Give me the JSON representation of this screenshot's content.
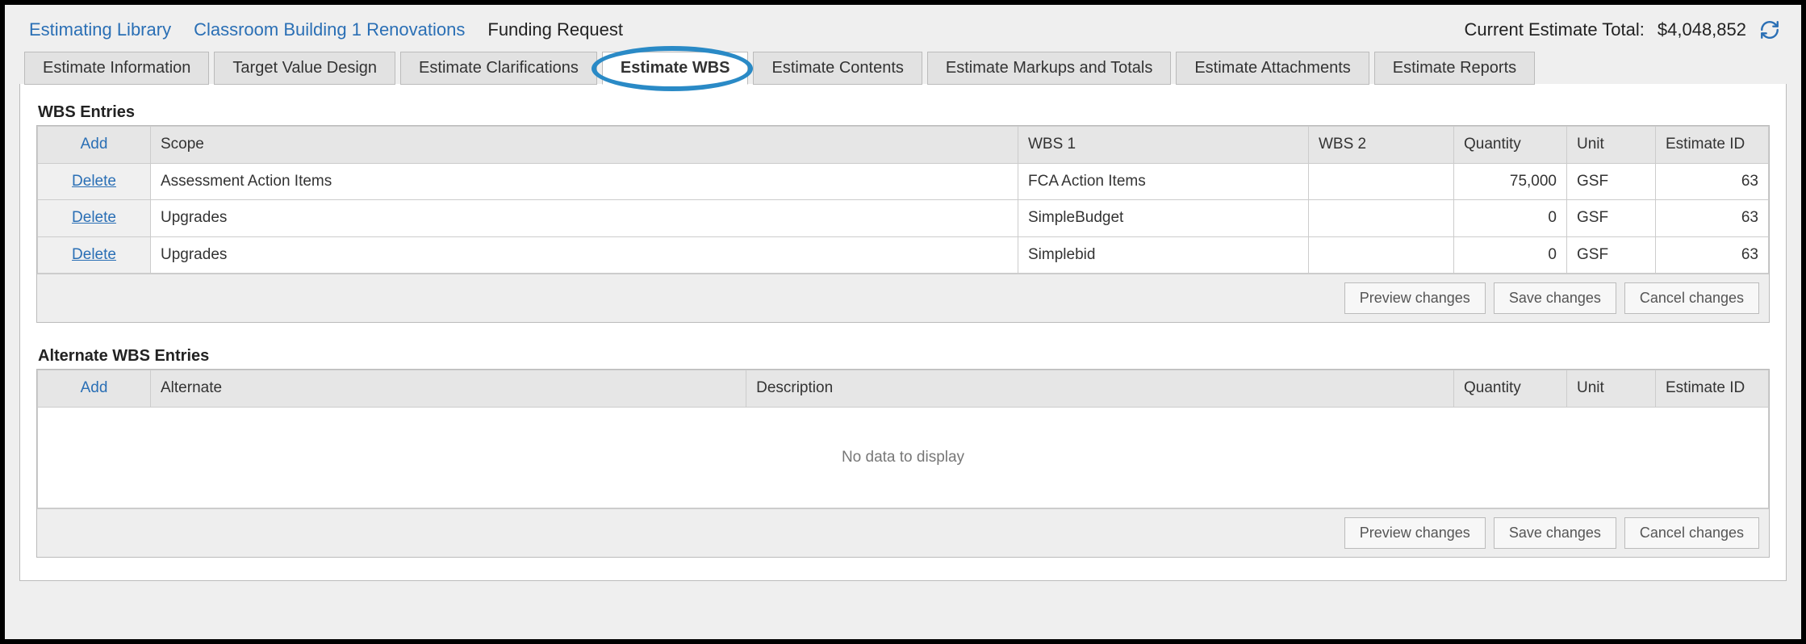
{
  "breadcrumbs": {
    "library": "Estimating Library",
    "project": "Classroom Building 1 Renovations",
    "page": "Funding Request"
  },
  "totals": {
    "label": "Current Estimate Total:",
    "value": "$4,048,852"
  },
  "tabs": [
    {
      "label": "Estimate Information",
      "active": false
    },
    {
      "label": "Target Value Design",
      "active": false
    },
    {
      "label": "Estimate Clarifications",
      "active": false
    },
    {
      "label": "Estimate WBS",
      "active": true
    },
    {
      "label": "Estimate Contents",
      "active": false
    },
    {
      "label": "Estimate Markups and Totals",
      "active": false
    },
    {
      "label": "Estimate Attachments",
      "active": false
    },
    {
      "label": "Estimate Reports",
      "active": false
    }
  ],
  "wbs": {
    "title": "WBS Entries",
    "add_label": "Add",
    "delete_label": "Delete",
    "columns": {
      "scope": "Scope",
      "wbs1": "WBS 1",
      "wbs2": "WBS 2",
      "qty": "Quantity",
      "unit": "Unit",
      "estid": "Estimate ID"
    },
    "rows": [
      {
        "scope": "Assessment Action Items",
        "wbs1": "FCA Action Items",
        "wbs2": "",
        "qty": "75,000",
        "unit": "GSF",
        "estid": "63"
      },
      {
        "scope": "Upgrades",
        "wbs1": "SimpleBudget",
        "wbs2": "",
        "qty": "0",
        "unit": "GSF",
        "estid": "63"
      },
      {
        "scope": "Upgrades",
        "wbs1": "Simplebid",
        "wbs2": "",
        "qty": "0",
        "unit": "GSF",
        "estid": "63"
      }
    ],
    "buttons": {
      "preview": "Preview changes",
      "save": "Save changes",
      "cancel": "Cancel changes"
    }
  },
  "alt": {
    "title": "Alternate WBS Entries",
    "add_label": "Add",
    "columns": {
      "alternate": "Alternate",
      "description": "Description",
      "qty": "Quantity",
      "unit": "Unit",
      "estid": "Estimate ID"
    },
    "empty": "No data to display",
    "buttons": {
      "preview": "Preview changes",
      "save": "Save changes",
      "cancel": "Cancel changes"
    }
  }
}
